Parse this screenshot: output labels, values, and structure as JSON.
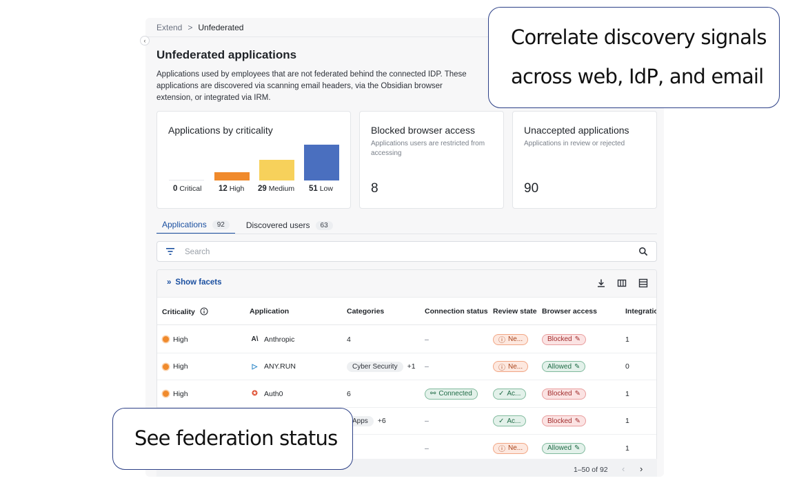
{
  "breadcrumb": {
    "parent": "Extend",
    "separator": ">",
    "current": "Unfederated"
  },
  "page": {
    "title": "Unfederated applications",
    "description": "Applications used by employees that are not federated behind the connected IDP. These applications are discovered via scanning email headers, via the Obsidian browser extension, or integrated via IRM."
  },
  "cards": {
    "criticality": {
      "title": "Applications by criticality",
      "items": [
        {
          "count": "0",
          "label": "Critical",
          "value": 0,
          "color": "#e0473d"
        },
        {
          "count": "12",
          "label": "High",
          "value": 12,
          "color": "#f08a2c"
        },
        {
          "count": "29",
          "label": "Medium",
          "value": 29,
          "color": "#f7d15b"
        },
        {
          "count": "51",
          "label": "Low",
          "value": 51,
          "color": "#4a6fbf"
        }
      ]
    },
    "blocked": {
      "title": "Blocked browser access",
      "subtitle": "Applications users are restricted from accessing",
      "value": "8"
    },
    "unaccepted": {
      "title": "Unaccepted applications",
      "subtitle": "Applications in review or rejected",
      "value": "90"
    }
  },
  "tabs": [
    {
      "label": "Applications",
      "count": "92"
    },
    {
      "label": "Discovered users",
      "count": "63"
    }
  ],
  "search": {
    "placeholder": "Search"
  },
  "toolbar": {
    "show_facets": "Show facets"
  },
  "table": {
    "headers": {
      "criticality": "Criticality",
      "application": "Application",
      "categories": "Categories",
      "connection": "Connection status",
      "review": "Review state",
      "browser": "Browser access",
      "integrations": "Integration"
    },
    "rows": [
      {
        "criticality": "High",
        "app": "Anthropic",
        "logo": "A\\",
        "categories": "4",
        "extra": "",
        "connection": "–",
        "review": "Ne...",
        "browser": "Blocked",
        "integrations": "1"
      },
      {
        "criticality": "High",
        "app": "ANY.RUN",
        "logo": "▷",
        "categories": "Cyber Security",
        "extra": "+1",
        "connection": "–",
        "review": "Ne...",
        "browser": "Allowed",
        "integrations": "0"
      },
      {
        "criticality": "High",
        "app": "Auth0",
        "logo": "✪",
        "categories": "6",
        "extra": "",
        "connection": "Connected",
        "review": "Ac...",
        "browser": "Blocked",
        "integrations": "1"
      },
      {
        "criticality": "",
        "app": "",
        "logo": "",
        "categories": "Apps",
        "extra": "+6",
        "connection": "–",
        "review": "Ac...",
        "browser": "Blocked",
        "integrations": "1"
      },
      {
        "criticality": "",
        "app": "",
        "logo": "",
        "categories": "",
        "extra": "",
        "connection": "–",
        "review": "Ne...",
        "browser": "Allowed",
        "integrations": "1"
      }
    ]
  },
  "pagination": {
    "range": "1–50 of 92",
    "prev": "‹",
    "next": "›"
  },
  "callouts": {
    "top_line1": "Correlate discovery signals",
    "top_line2": "across web, IdP, and email",
    "bottom": "See federation status"
  }
}
